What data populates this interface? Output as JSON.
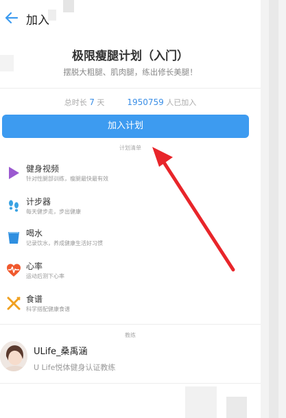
{
  "header": {
    "title": "加入",
    "back_icon": "arrow-left-icon"
  },
  "plan": {
    "title": "极限瘦腿计划（入门）",
    "subtitle": "摆脱大粗腿、肌肉腿，练出修长美腿！"
  },
  "stats": {
    "duration_label": "总时长",
    "duration_value": "7",
    "duration_unit": "天",
    "joined_count": "1950759",
    "joined_label": "人已加入"
  },
  "join_button": "加入计划",
  "plan_list_label": "计划清单",
  "plan_items": [
    {
      "title": "健身视频",
      "desc": "针对性腿部训练，瘦腿最快最有效",
      "icon": "play-icon",
      "color": "#9b59d0"
    },
    {
      "title": "计步器",
      "desc": "每天健步走，步出健康",
      "icon": "footprint-icon",
      "color": "#3aa3e3"
    },
    {
      "title": "喝水",
      "desc": "记录饮水，养成健康生活好习惯",
      "icon": "cup-icon",
      "color": "#2f8fe0"
    },
    {
      "title": "心率",
      "desc": "运动后测下心率",
      "icon": "heart-rate-icon",
      "color": "#f0592e"
    },
    {
      "title": "食谱",
      "desc": "科学搭配健康食谱",
      "icon": "utensils-icon",
      "color": "#f0a020"
    }
  ],
  "coach_label": "教练",
  "coach": {
    "name": "ULife_桑禹涵",
    "desc": "U Life悦体健身认证教练"
  },
  "colors": {
    "accent": "#3d9bf0",
    "annotation_arrow": "#e8252a"
  }
}
